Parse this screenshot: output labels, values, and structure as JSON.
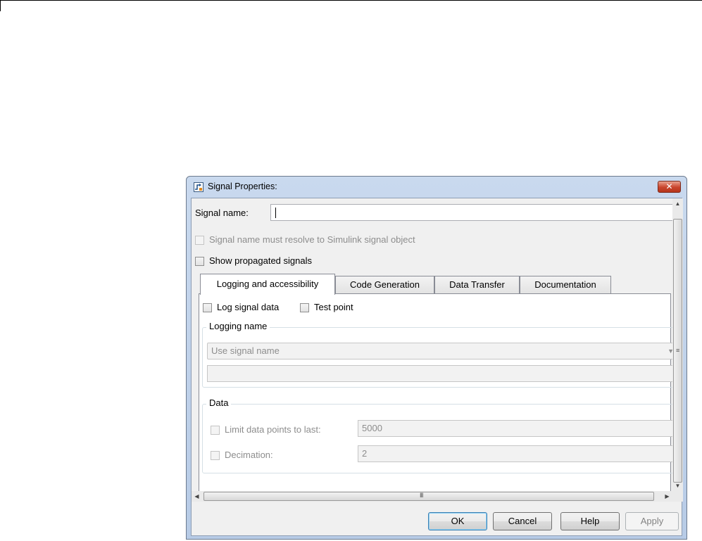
{
  "dialog": {
    "title": "Signal Properties:",
    "close_glyph": "✕",
    "icon": "signal-properties-icon"
  },
  "signal_name": {
    "label": "Signal name:",
    "value": ""
  },
  "resolve_checkbox": {
    "label": "Signal name must resolve to Simulink signal object",
    "checked": false,
    "enabled": false
  },
  "show_propagated": {
    "label": "Show propagated signals",
    "checked": false
  },
  "tabs": [
    {
      "label": "Logging and accessibility",
      "active": true
    },
    {
      "label": "Code Generation",
      "active": false
    },
    {
      "label": "Data Transfer",
      "active": false
    },
    {
      "label": "Documentation",
      "active": false
    }
  ],
  "logging": {
    "log_signal_data": {
      "label": "Log signal data",
      "checked": false
    },
    "test_point": {
      "label": "Test point",
      "checked": false
    },
    "logging_name": {
      "group_title": "Logging name",
      "select_value": "Use signal name",
      "custom_value": ""
    },
    "data": {
      "group_title": "Data",
      "limit_points": {
        "label": "Limit data points to last:",
        "value": "5000",
        "checked": false
      },
      "decimation": {
        "label": "Decimation:",
        "value": "2",
        "checked": false
      }
    }
  },
  "buttons": {
    "ok": "OK",
    "cancel": "Cancel",
    "help": "Help",
    "apply": "Apply"
  },
  "scrollbar_glyphs": {
    "up": "▲",
    "down": "▼",
    "left": "◀",
    "right": "▶",
    "grip_h": "III",
    "grip_v": "≡"
  },
  "colors": {
    "title_bar": "#c9d9ee",
    "close_button": "#c9452c",
    "default_button_border": "#3c7fb1"
  }
}
